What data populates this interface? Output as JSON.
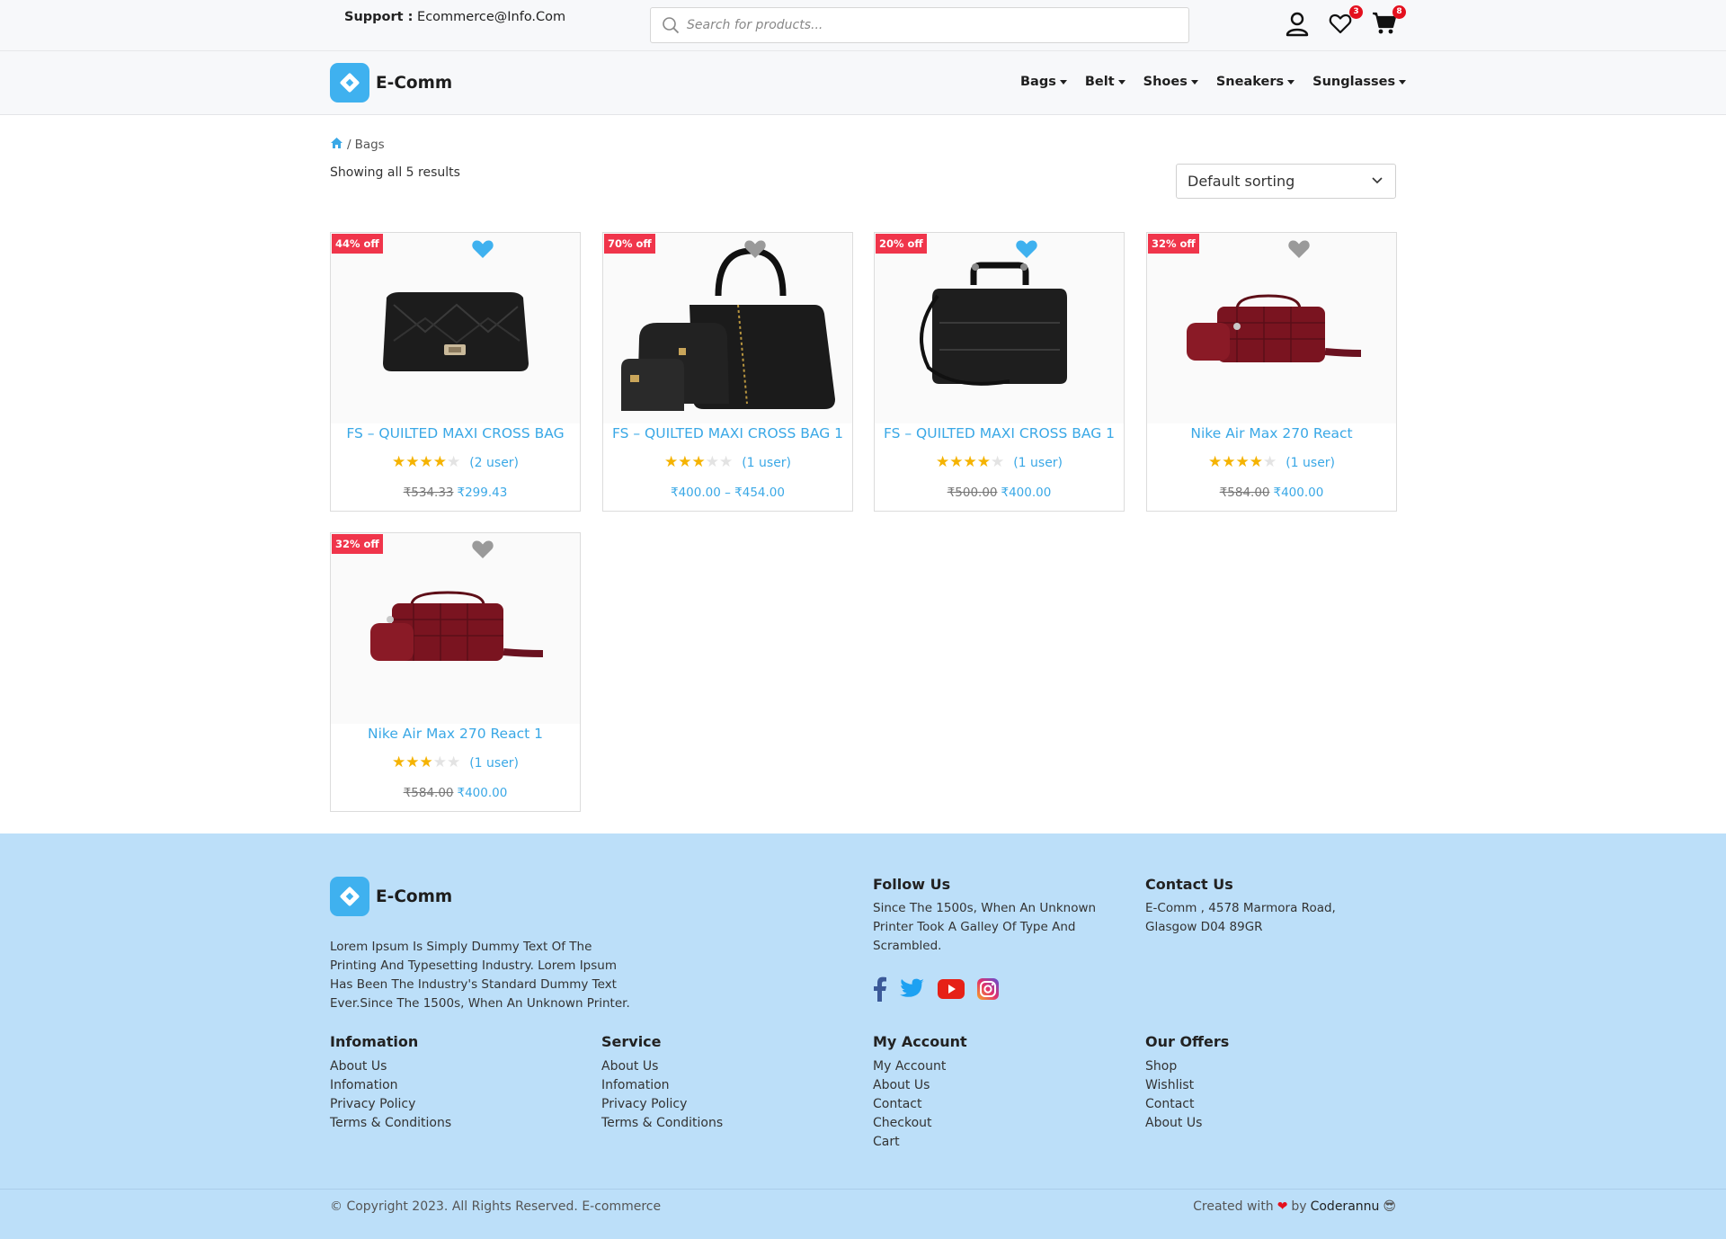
{
  "header": {
    "support_label": "Support :",
    "support_email": "Ecommerce@Info.Com",
    "search_placeholder": "Search for products...",
    "wishlist_count": "3",
    "cart_count": "8"
  },
  "nav": {
    "logo_text": "E-Comm",
    "items": [
      {
        "label": "Bags"
      },
      {
        "label": "Belt"
      },
      {
        "label": "Shoes"
      },
      {
        "label": "Sneakers"
      },
      {
        "label": "Sunglasses"
      }
    ]
  },
  "breadcrumb": {
    "separator": "/",
    "current": "Bags"
  },
  "results_text": "Showing all 5 results",
  "sort": {
    "selected": "Default sorting"
  },
  "products": [
    {
      "discount": "44% off",
      "title": "FS – QUILTED MAXI CROSS BAG",
      "rating": 4,
      "reviews": "(2 user)",
      "old_price": "₹534.33",
      "price": "₹299.43",
      "wishlisted": true
    },
    {
      "discount": "70% off",
      "title": "FS – QUILTED MAXI CROSS BAG 1",
      "rating": 3,
      "reviews": "(1 user)",
      "old_price": "",
      "price": "₹400.00 – ₹454.00",
      "wishlisted": false
    },
    {
      "discount": "20% off",
      "title": "FS – QUILTED MAXI CROSS BAG 1",
      "rating": 4,
      "reviews": "(1 user)",
      "old_price": "₹500.00",
      "price": "₹400.00",
      "wishlisted": true
    },
    {
      "discount": "32% off",
      "title": "Nike Air Max 270 React",
      "rating": 4,
      "reviews": "(1 user)",
      "old_price": "₹584.00",
      "price": "₹400.00",
      "wishlisted": false
    },
    {
      "discount": "32% off",
      "title": "Nike Air Max 270 React 1",
      "rating": 3,
      "reviews": "(1 user)",
      "old_price": "₹584.00",
      "price": "₹400.00",
      "wishlisted": false
    }
  ],
  "footer": {
    "logo_text": "E-Comm",
    "description": "Lorem Ipsum Is Simply Dummy Text Of The Printing And Typesetting Industry. Lorem Ipsum Has Been The Industry's Standard Dummy Text Ever.Since The 1500s, When An Unknown Printer.",
    "follow": {
      "heading": "Follow Us",
      "text": "Since The 1500s, When An Unknown Printer Took A Galley Of Type And Scrambled."
    },
    "contact": {
      "heading": "Contact Us",
      "text": "E-Comm , 4578 Marmora Road, Glasgow D04 89GR"
    },
    "columns": [
      {
        "heading": "Infomation",
        "links": [
          "About Us",
          "Infomation",
          "Privacy Policy",
          "Terms & Conditions"
        ]
      },
      {
        "heading": "Service",
        "links": [
          "About Us",
          "Infomation",
          "Privacy Policy",
          "Terms & Conditions"
        ]
      },
      {
        "heading": "My Account",
        "links": [
          "My Account",
          "About Us",
          "Contact",
          "Checkout",
          "Cart"
        ]
      },
      {
        "heading": "Our Offers",
        "links": [
          "Shop",
          "Wishlist",
          "Contact",
          "About Us"
        ]
      }
    ],
    "copyright": "© Copyright 2023. All Rights Reserved. E-commerce",
    "credit_prefix": "Created with",
    "credit_by": "by",
    "credit_author": "Coderannu",
    "credit_emoji": "😎"
  },
  "colors": {
    "accent": "#3fb1ef",
    "link": "#3aa8e6",
    "discount": "#f0354b",
    "star": "#f5b301",
    "footer_bg": "#bcdff9",
    "badge": "#e4101e"
  }
}
